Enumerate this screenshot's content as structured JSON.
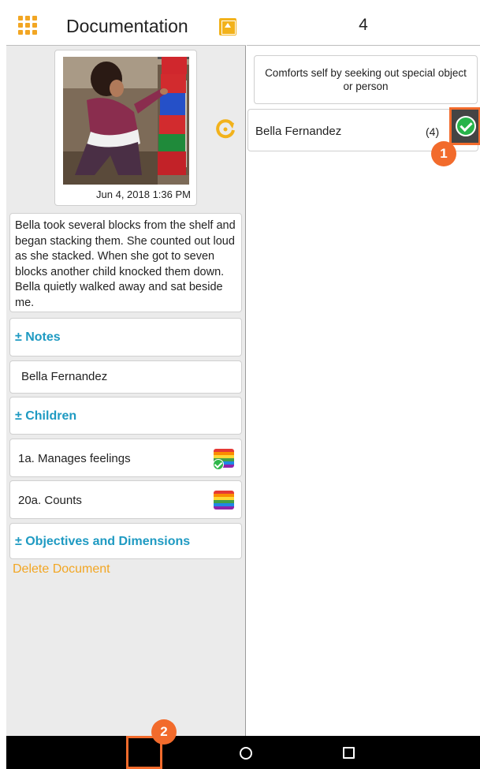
{
  "left_header": {
    "title": "Documentation"
  },
  "photo": {
    "date": "Jun  4, 2018 1:36 PM"
  },
  "observation": {
    "text": "Bella took several blocks from the shelf and began stacking them. She counted out loud as she stacked. When she got to seven blocks another child knocked them down. Bella quietly walked away and sat beside me."
  },
  "notes": {
    "label": "± Notes"
  },
  "child_name_row": {
    "label": "Bella Fernandez"
  },
  "children": {
    "label": "± Children"
  },
  "objective_rows": [
    {
      "label": "1a. Manages feelings",
      "checked": true
    },
    {
      "label": "20a. Counts",
      "checked": false
    }
  ],
  "objectives_dimensions": {
    "label": "± Objectives and Dimensions"
  },
  "delete": {
    "label": "Delete Document"
  },
  "right_header": {
    "title": "4"
  },
  "objective_card": {
    "text": "Comforts self by seeking out special object or person"
  },
  "child_row": {
    "name": "Bella Fernandez",
    "count": "(4)",
    "checked": true
  },
  "markers": {
    "one": "1",
    "two": "2"
  },
  "colors": {
    "accent_orange": "#f26b2c",
    "link_blue": "#1e9ac2",
    "delete_yellow": "#f2a623",
    "check_green": "#27b34a"
  },
  "icons": [
    "grid-menu-icon",
    "upload-icon",
    "refresh-icon",
    "check-icon",
    "back-icon",
    "home-icon",
    "recent-apps-icon"
  ]
}
